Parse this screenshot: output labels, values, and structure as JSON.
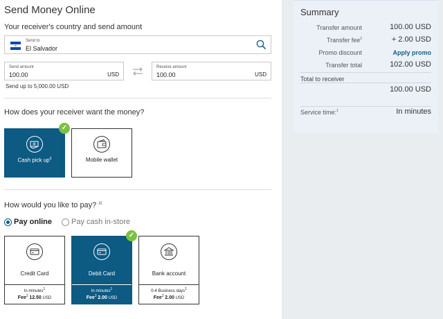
{
  "page": {
    "title": "Send Money Online",
    "receiver_subtitle": "Your receiver's country and send amount"
  },
  "country_field": {
    "label": "Send to",
    "value": "El Salvador"
  },
  "send_amount": {
    "label": "Send amount",
    "value": "100.00",
    "currency": "USD",
    "limit_hint": "Send up to 5,000.00 USD"
  },
  "receive_amount": {
    "label": "Receive amount",
    "value": "100.00",
    "currency": "USD"
  },
  "delivery": {
    "question": "How does your receiver want the money?",
    "options": [
      {
        "label": "Cash pick up",
        "sup": "6",
        "selected": true
      },
      {
        "label": "Mobile wallet",
        "selected": false
      }
    ]
  },
  "payment": {
    "question": "How would you like to pay?",
    "question_sup": "31",
    "radio_online": "Pay online",
    "radio_cash": "Pay cash in-store",
    "methods": [
      {
        "label": "Credit Card",
        "time": "In minutes",
        "time_sup": "1",
        "fee_prefix": "Fee",
        "fee_sup": "2",
        "fee": "12.50",
        "currency": "USD",
        "selected": false
      },
      {
        "label": "Debit Card",
        "time": "In minutes",
        "time_sup": "1",
        "fee_prefix": "Fee",
        "fee_sup": "2",
        "fee": "2.00",
        "currency": "USD",
        "selected": true
      },
      {
        "label": "Bank account",
        "time": "0-4 Business days",
        "time_sup": "1",
        "fee_prefix": "Fee",
        "fee_sup": "2",
        "fee": "2.00",
        "currency": "USD",
        "selected": false
      }
    ]
  },
  "summary": {
    "title": "Summary",
    "transfer_amount_label": "Transfer amount",
    "transfer_amount_value": "100.00 USD",
    "transfer_fee_label": "Transfer fee",
    "transfer_fee_sup": "2",
    "transfer_fee_value": "+ 2.00 USD",
    "promo_label": "Promo discount",
    "promo_link": "Apply promo",
    "transfer_total_label": "Transfer total",
    "transfer_total_value": "102.00 USD",
    "total_receiver_label": "Total  to receiver",
    "total_receiver_value": "100.00 USD",
    "service_time_label": "Service time:",
    "service_time_sup": "1",
    "service_time_value": "In minutes"
  },
  "colors": {
    "primary": "#0d5a83",
    "check": "#7ac143",
    "summary_bg": "#ecf1f8",
    "side_bg": "#e9edef"
  }
}
